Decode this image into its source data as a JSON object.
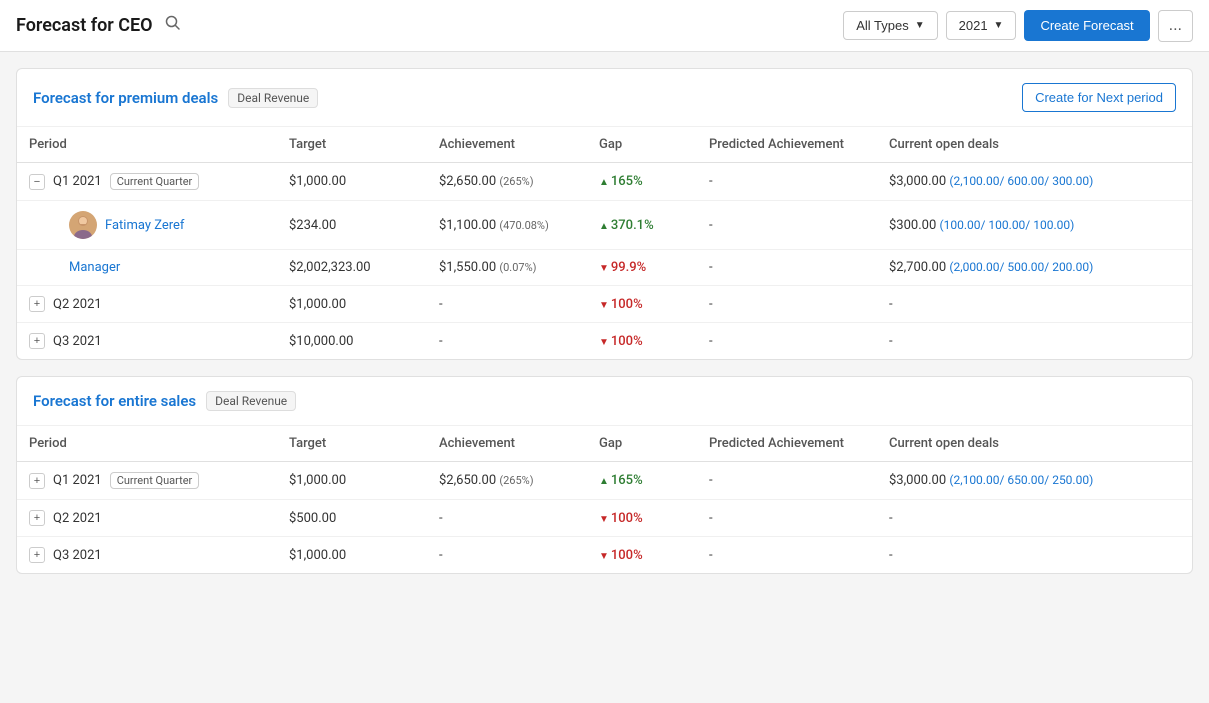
{
  "header": {
    "title": "Forecast for CEO",
    "search_tooltip": "Search",
    "filter_type_label": "All Types",
    "filter_year_label": "2021",
    "create_forecast_label": "Create Forecast",
    "more_label": "..."
  },
  "cards": [
    {
      "id": "premium",
      "title": "Forecast for premium deals",
      "badge": "Deal Revenue",
      "create_next_label": "Create for Next period",
      "columns": [
        "Period",
        "Target",
        "Achievement",
        "Gap",
        "Predicted Achievement",
        "Current open deals"
      ],
      "rows": [
        {
          "type": "expandable_open",
          "period": "Q1 2021",
          "current_quarter": true,
          "target": "$1,000.00",
          "achievement": "$2,650.00",
          "achievement_pct": "265%",
          "gap_value": "165%",
          "gap_dir": "positive",
          "predicted": "-",
          "open_deals_main": "$3,000.00",
          "open_deals_sub": "(2,100.00/ 600.00/ 300.00)"
        },
        {
          "type": "sub_person",
          "period": "Fatimay Zeref",
          "is_link": true,
          "has_avatar": true,
          "target": "$234.00",
          "achievement": "$1,100.00",
          "achievement_pct": "470.08%",
          "gap_value": "370.1%",
          "gap_dir": "positive",
          "predicted": "-",
          "open_deals_main": "$300.00",
          "open_deals_sub": "(100.00/ 100.00/ 100.00)"
        },
        {
          "type": "sub_person",
          "period": "Manager",
          "is_link": true,
          "has_avatar": false,
          "target": "$2,002,323.00",
          "achievement": "$1,550.00",
          "achievement_pct": "0.07%",
          "gap_value": "99.9%",
          "gap_dir": "negative",
          "predicted": "-",
          "open_deals_main": "$2,700.00",
          "open_deals_sub": "(2,000.00/ 500.00/ 200.00)"
        },
        {
          "type": "expandable_closed",
          "period": "Q2 2021",
          "current_quarter": false,
          "target": "$1,000.00",
          "achievement": "-",
          "achievement_pct": "",
          "gap_value": "100%",
          "gap_dir": "negative",
          "predicted": "-",
          "open_deals_main": "-",
          "open_deals_sub": ""
        },
        {
          "type": "expandable_closed",
          "period": "Q3 2021",
          "current_quarter": false,
          "target": "$10,000.00",
          "achievement": "-",
          "achievement_pct": "",
          "gap_value": "100%",
          "gap_dir": "negative",
          "predicted": "-",
          "open_deals_main": "-",
          "open_deals_sub": ""
        }
      ]
    },
    {
      "id": "entire_sales",
      "title": "Forecast for entire sales",
      "badge": "Deal Revenue",
      "create_next_label": "",
      "columns": [
        "Period",
        "Target",
        "Achievement",
        "Gap",
        "Predicted Achievement",
        "Current open deals"
      ],
      "rows": [
        {
          "type": "expandable_closed",
          "period": "Q1 2021",
          "current_quarter": true,
          "target": "$1,000.00",
          "achievement": "$2,650.00",
          "achievement_pct": "265%",
          "gap_value": "165%",
          "gap_dir": "positive",
          "predicted": "-",
          "predicted_highlight": false,
          "open_deals_main": "$3,000.00",
          "open_deals_sub": "(2,100.00/ 650.00/ 250.00)"
        },
        {
          "type": "expandable_closed",
          "period": "Q2 2021",
          "current_quarter": false,
          "target": "$500.00",
          "achievement": "-",
          "achievement_pct": "",
          "gap_value": "100%",
          "gap_dir": "negative",
          "predicted": "-",
          "predicted_highlight": false,
          "open_deals_main": "-",
          "open_deals_sub": ""
        },
        {
          "type": "expandable_closed",
          "period": "Q3 2021",
          "current_quarter": false,
          "target": "$1,000.00",
          "achievement": "-",
          "achievement_pct": "",
          "gap_value": "100%",
          "gap_dir": "negative",
          "predicted": "-",
          "predicted_highlight": false,
          "open_deals_main": "-",
          "open_deals_sub": ""
        }
      ]
    }
  ]
}
